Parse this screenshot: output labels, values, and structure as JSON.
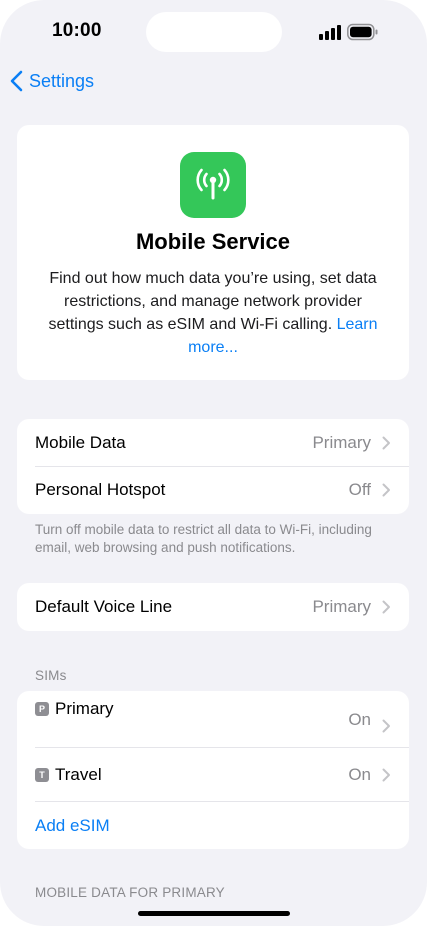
{
  "status": {
    "time": "10:00"
  },
  "nav": {
    "back_label": "Settings"
  },
  "hero": {
    "title": "Mobile Service",
    "description": "Find out how much data you’re using, set data restrictions, and manage network provider settings such as eSIM and Wi-Fi calling.",
    "link": "Learn more..."
  },
  "group1": {
    "rows": [
      {
        "label": "Mobile Data",
        "value": "Primary"
      },
      {
        "label": "Personal Hotspot",
        "value": "Off"
      }
    ],
    "footnote": "Turn off mobile data to restrict all data to Wi-Fi, including email, web browsing and push notifications."
  },
  "group2": {
    "rows": [
      {
        "label": "Default Voice Line",
        "value": "Primary"
      }
    ]
  },
  "sims": {
    "header": "SIMs",
    "rows": [
      {
        "tag": "P",
        "label": "Primary",
        "value": "On"
      },
      {
        "tag": "T",
        "label": "Travel",
        "value": "On"
      }
    ],
    "add_label": "Add eSIM"
  },
  "mobile_data_header": "MOBILE DATA FOR PRIMARY",
  "colors": {
    "accent": "#0a7ff5",
    "icon_green": "#34c759",
    "background": "#f2f2f7"
  }
}
